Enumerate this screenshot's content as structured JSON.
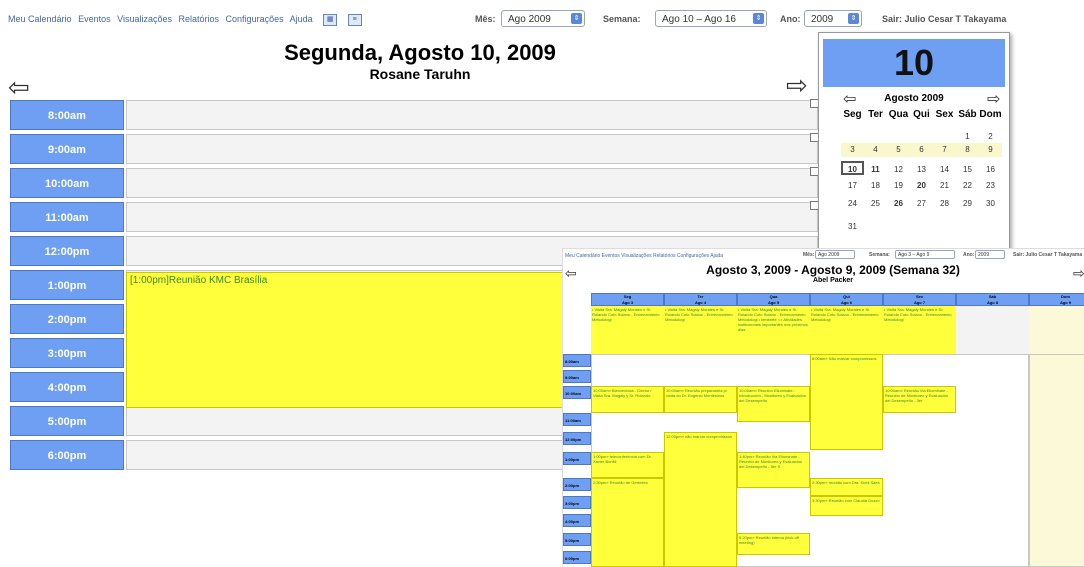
{
  "menu": {
    "items": [
      "Meu Calendário",
      "Eventos",
      "Visualizações",
      "Relatórios",
      "Configurações",
      "Ajuda"
    ]
  },
  "controls": {
    "month_label": "Mês:",
    "month_value": "Ago 2009",
    "week_label": "Semana:",
    "week_value": "Ago 10 – Ago 16",
    "year_label": "Ano:",
    "year_value": "2009",
    "logout": "Sair: Julio Cesar T Takayama"
  },
  "day_view": {
    "title": "Segunda, Agosto 10, 2009",
    "user": "Rosane Taruhn",
    "times": [
      "8:00am",
      "9:00am",
      "10:00am",
      "11:00am",
      "12:00pm",
      "1:00pm",
      "2:00pm",
      "3:00pm",
      "4:00pm",
      "5:00pm",
      "6:00pm"
    ],
    "event": "[1:00pm]Reunião KMC Brasília"
  },
  "mini_calendar": {
    "day": "10",
    "month": "Agosto 2009",
    "weekdays": [
      "Seg",
      "Ter",
      "Qua",
      "Qui",
      "Sex",
      "Sáb",
      "Dom"
    ],
    "weeks": [
      [
        "",
        "",
        "",
        "",
        "",
        "1",
        "2"
      ],
      [
        "3",
        "4",
        "5",
        "6",
        "7",
        "8",
        "9"
      ],
      [
        "10",
        "11",
        "12",
        "13",
        "14",
        "15",
        "16"
      ],
      [
        "17",
        "18",
        "19",
        "20",
        "21",
        "22",
        "23"
      ],
      [
        "24",
        "25",
        "26",
        "27",
        "28",
        "29",
        "30"
      ],
      [
        "31",
        "",
        "",
        "",
        "",
        "",
        ""
      ]
    ]
  },
  "week_view": {
    "menu": "Meu Calendário  Eventos  Visualizações  Relatórios  Configurações  Ajuda",
    "month_label": "Mês:",
    "month_value": "Ago 2009",
    "week_label": "Semana:",
    "week_value": "Ago 3 – Ago 9",
    "year_label": "Ano:",
    "year_value": "2009",
    "logout": "Sair: Julio Cesar T Takayama",
    "title": "Agosto 3, 2009   -   Agosto 9, 2009 (Semana 32)",
    "user": "Abel Packer",
    "days": [
      {
        "name": "Seg",
        "date": "Ago 3"
      },
      {
        "name": "Ter",
        "date": "Ago 4"
      },
      {
        "name": "Qua",
        "date": "Ago 5"
      },
      {
        "name": "Qui",
        "date": "Ago 6"
      },
      {
        "name": "Sex",
        "date": "Ago 7"
      },
      {
        "name": "Sáb",
        "date": "Ago 8"
      },
      {
        "name": "Dom",
        "date": "Ago 9"
      }
    ],
    "allday": [
      "• Visita Sra. Magaly Morales e Sr. Rolando Coto Solano - Entrenamiento Metodologi",
      "• Visita Sra. Magaly Morales e Sr. Rolando Coto Solano - Entrenamiento Metodologi",
      "• Visita Sra. Magaly Morales e Sr. Rolando Coto Solano - Entrenamiento Metodologi • lembrete => Atividades institucionais importantes nos próximos dias",
      "• Visita Sra. Magaly Morales e Sr. Rolando Coto Solano - Entrenamiento Metodologi",
      "• Visita Sra. Magaly Morales e Sr. Rolando Coto Solano - Entrenamiento Metodologi",
      "",
      ""
    ],
    "times": [
      "8:00am",
      "9:00am",
      "10:00am",
      "11:00am",
      "12:00pm",
      "1:00pm",
      "2:00pm",
      "3:00pm",
      "4:00pm",
      "5:00pm",
      "6:00pm"
    ],
    "events": {
      "mon_1000": "10:00am» Bienvenidas - Diretor / Visita Sra. Magaly y Sr. Rolando",
      "mon_1300": "1:00pm» teleconferência com Dr. Xavier Bonfill",
      "mon_1430": "2:30pm» Reunião de Gerentes",
      "tue_1000": "10:00am» Reunião preparatória p/ visita do Dr. Eugenio Montesinos",
      "tue_1200": "12:00pm» não marcar compromissos",
      "wed_1000": "10:00am» Reunión Eliuminate - Introducción - Monitoreo y Evaluación del Desempeño",
      "wed_1340": "1:40pm» Reunião Via Eliuminate - Reunión de Monitoreo y Evaluación del Desempeño - 3er S",
      "wed_1720": "5:20pm» Reunião interna (kick-off meeting)",
      "thu_0800": "8:00am» Não marcar compromissos",
      "thu_1430": "2:30pm» reunião com Dra. Sueli Saes",
      "thu_1530": "3:30pm» Reunião com Claudia Guzzo",
      "fri_1000": "10:00am» Reunião Via Eliuminate - Reunión de Monitoreo y Evaluación del Desempeño - 3er"
    }
  }
}
